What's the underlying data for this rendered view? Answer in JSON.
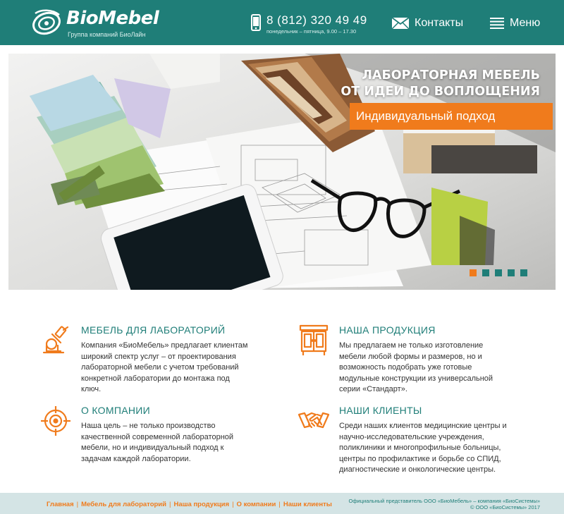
{
  "header": {
    "logo_text": "BioMebel",
    "logo_subtitle": "Группа компаний БиоЛайн",
    "phone": "8 (812) 320 49 49",
    "phone_hours": "понедельник – пятница, 9.00 – 17.30",
    "contacts_label": "Контакты",
    "menu_label": "Меню"
  },
  "hero": {
    "title_line1": "ЛАБОРАТОРНАЯ МЕБЕЛЬ",
    "title_line2": "ОТ ИДЕИ ДО ВОПЛОЩЕНИЯ",
    "badge": "Индивидуальный подход",
    "slides_count": 5,
    "active_slide": 1
  },
  "features": [
    {
      "icon": "microscope-icon",
      "title": "МЕБЕЛЬ ДЛЯ ЛАБОРАТОРИЙ",
      "text": "Компания «БиоМебель» предлагает клиентам широкий спектр услуг – от проектирования лабораторной мебели с учетом требований конкретной лаборатории до монтажа под ключ."
    },
    {
      "icon": "cabinet-icon",
      "title": "НАША ПРОДУКЦИЯ",
      "text": "Мы предлагаем не только изготовление мебели любой формы и размеров, но и возможность подобрать уже готовые модульные конструкции из универсальной серии «Стандарт»."
    },
    {
      "icon": "target-icon",
      "title": "О КОМПАНИИ",
      "text": "Наша цель – не только производство качественной современной лабораторной мебели, но и индивидуальный подход к задачам каждой лаборатории."
    },
    {
      "icon": "handshake-icon",
      "title": "НАШИ КЛИЕНТЫ",
      "text": "Среди наших клиентов медицинские центры и научно-исследовательские учреждения, поликлиники и многопрофильные больницы, центры по профилактике и борьбе со СПИД, диагностические и онкологические центры."
    }
  ],
  "footer": {
    "nav": [
      "Главная",
      "Мебель для лабораторий",
      "Наша продукция",
      "О компании",
      "Наши клиенты"
    ],
    "separator": "|",
    "official": "Официальный представитель ООО «БиоМебель» – компания «БиоСистемы»",
    "copyright": "© ООО «БиоСистемы» 2017"
  },
  "colors": {
    "brand": "#1f7e78",
    "accent": "#f07b1c",
    "footer_bg": "#d4e4e5"
  }
}
